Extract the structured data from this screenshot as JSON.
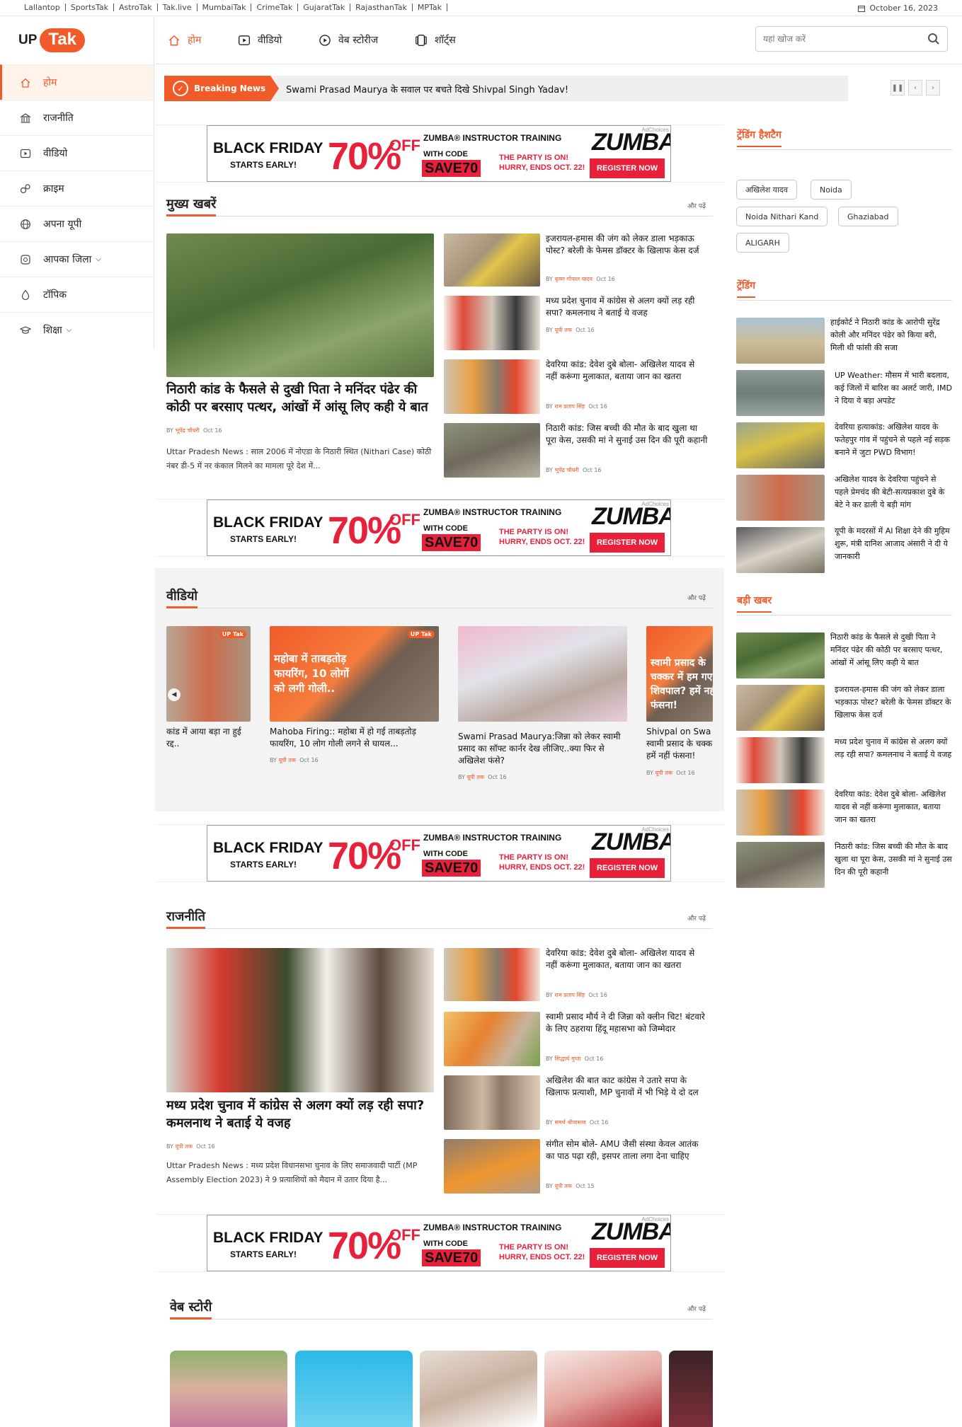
{
  "network_links": [
    "Lallantop",
    "SportsTak",
    "AstroTak",
    "Tak.live",
    "MumbaiTak",
    "CrimeTak",
    "GujaratTak",
    "RajasthanTak",
    "MPTak"
  ],
  "date": "October 16, 2023",
  "logo": {
    "up": "UP",
    "tak": "Tak"
  },
  "sidebar": {
    "items": [
      {
        "label": "होम",
        "icon": "home-icon"
      },
      {
        "label": "राजनीति",
        "icon": "parliament-icon"
      },
      {
        "label": "वीडियो",
        "icon": "video-icon"
      },
      {
        "label": "क्राइम",
        "icon": "handcuff-icon"
      },
      {
        "label": "अपना यूपी",
        "icon": "globe-icon"
      },
      {
        "label": "आपका जिला",
        "icon": "district-icon"
      },
      {
        "label": "टॉपिक",
        "icon": "topic-icon"
      },
      {
        "label": "शिक्षा",
        "icon": "graduation-cap-icon"
      }
    ]
  },
  "topnav": {
    "items": [
      {
        "label": "होम",
        "icon": "home-icon"
      },
      {
        "label": "वीडियो",
        "icon": "video-icon"
      },
      {
        "label": "वेब स्टोरीज",
        "icon": "web-stories-icon"
      },
      {
        "label": "शॉर्ट्स",
        "icon": "shorts-icon"
      }
    ],
    "search_placeholder": "यहां खोज करें"
  },
  "breaking": {
    "tag": "Breaking News",
    "text": "Swami Prasad Maurya के सवाल पर बचते दिखे Shivpal Singh Yadav!"
  },
  "ad": {
    "black_friday": "BLACK FRIDAY",
    "starts_early": "STARTS EARLY!",
    "percent": "70%",
    "off": "OFF",
    "zumba_instructor": "ZUMBA® INSTRUCTOR TRAINING",
    "with_code": "WITH CODE",
    "code": "SAVE70",
    "party": "THE PARTY IS ON!",
    "hurry": "HURRY, ENDS OCT. 22!",
    "zumba": "ZUMBA",
    "register": "REGISTER NOW",
    "adchoices": "AdChoices"
  },
  "more_label": "और पढ़ें",
  "main_news": {
    "title": "मुख्य खबरें",
    "lead": {
      "title": "निठारी कांड के फैसले से दुखी पिता ने मनिंदर पंढेर की कोठी पर बरसाए पत्थर, आंखों में आंसू लिए कही ये बात",
      "by": "BY",
      "author": "भूपेंद्र चौधरी",
      "date": "Oct 16",
      "summary": "Uttar Pradesh News : साल 2006 में नोएडा के निठारी स्थित (Nithari Case) कोठी नंबर डी-5 में नर कंकाल मिलने का मामला पूरे देश में..."
    },
    "items": [
      {
        "title": "इजरायल-हमास की जंग को लेकर डाला भड़काऊ पोस्ट? बरेली के फेमस डॉक्टर के खिलाफ केस दर्ज",
        "author": "कृष्ण गोपाल यादव",
        "date": "Oct 16"
      },
      {
        "title": "मध्य प्रदेश चुनाव में कांग्रेस से अलग क्यों लड़ रही सपा? कमलनाथ ने बताई ये वजह",
        "author": "यूपी तक",
        "date": "Oct 16"
      },
      {
        "title": "देवरिया कांड: देवेश दुबे बोला- अखिलेश यादव से नहीं करूंगा मुलाकात, बताया जान का खतरा",
        "author": "राम प्रताप सिंह",
        "date": "Oct 16"
      },
      {
        "title": "निठारी कांड: जिस बच्ची की मौत के बाद खुला था पूरा केस, उसकी मां ने सुनाई उस दिन की पूरी कहानी",
        "author": "भूपेंद्र चौधरी",
        "date": "Oct 16"
      }
    ]
  },
  "videos": {
    "title": "वीडियो",
    "items": [
      {
        "title": "कांड में आया बड़ा ना हुई रद्द..",
        "author": "",
        "date": "",
        "overlay": ""
      },
      {
        "title": "Mahoba Firing:: महोबा में हो गई ताबड़तोड़ फायरिंग, 10 लोग गोली लगने से घायल...",
        "author": "यूपी तक",
        "date": "Oct 16",
        "overlay": "महोबा में ताबड़तोड़ फायरिंग, 10 लोगों को लगी गोली.."
      },
      {
        "title": "Swami Prasad Maurya:जिन्ना को लेकर स्वामी प्रसाद का सॉफ्ट कार्नर देख लीजिए..क्या फिर से अखिलेश फंसे?",
        "author": "यूपी तक",
        "date": "Oct 16",
        "overlay": ""
      },
      {
        "title": "Shivpal on Swa स्वामी प्रसाद के चक्क हमें नहीं फंसना!",
        "author": "यूपी तक",
        "date": "Oct 16",
        "overlay": "स्वामी प्रसाद के चक्कर में हम गए शिवपाल? हमें नहीं फंसना!"
      }
    ],
    "badge": "UP Tak"
  },
  "politics": {
    "title": "राजनीति",
    "lead": {
      "title": "मध्य प्रदेश चुनाव में कांग्रेस से अलग क्यों लड़ रही सपा? कमलनाथ ने बताई ये वजह",
      "author": "यूपी तक",
      "date": "Oct 16",
      "summary": "Uttar Pradesh News : मध्य प्रदेश विधानसभा चुनाव के लिए समाजवादी पार्टी (MP Assembly Election 2023) ने 9 प्रत्याशियों को मैदान में उतार दिया है..."
    },
    "items": [
      {
        "title": "देवरिया कांड: देवेश दुबे बोला- अखिलेश यादव से नहीं करूंगा मुलाकात, बताया जान का खतरा",
        "author": "राम प्रताप सिंह",
        "date": "Oct 16"
      },
      {
        "title": "स्वामी प्रसाद मौर्य ने दी जिन्ना को क्लीन चिट! बंटवारे के लिए ठहराया हिंदू महासभा को जिम्मेदार",
        "author": "सिद्धार्थ गुप्ता",
        "date": "Oct 16"
      },
      {
        "title": "अखिलेश की बात काट कांग्रेस ने उतारे सपा के खिलाफ प्रत्याशी, MP चुनावों में भी भिड़े ये दो दल",
        "author": "समर्थ श्रीवास्तव",
        "date": "Oct 16"
      },
      {
        "title": "संगीत सोम बोले- AMU जैसी संस्था केवल आतंक का पाठ पढ़ा रही, इसपर ताला लगा देना चाहिए",
        "author": "यूपी तक",
        "date": "Oct 15"
      }
    ]
  },
  "web_story": {
    "title": "वेब स्टोरी"
  },
  "trending_hashtags": {
    "title": "ट्रेंडिंग हैशटैग",
    "tags": [
      "अखिलेश यादव",
      "Noida",
      "Noida Nithari Kand",
      "Ghaziabad",
      "ALIGARH"
    ]
  },
  "trending": {
    "title": "ट्रेंडिंग",
    "items": [
      "हाईकोर्ट ने निठारी कांड के आरोपी सुरेंद्र कोली और मनिंदर पंढेर को किया बरी, मिली थी फांसी की सजा",
      "UP Weather: मौसम में भारी बदलाव, कई जिलों में बारिश का अलर्ट जारी, IMD ने दिया ये बड़ा अपडेट",
      "देवरिया हत्याकांड: अखिलेश यादव के फतेहपुर गांव में पहुंचने से पहले नई सड़क बनाने में जुटा PWD विभाग!",
      "अखिलेश यादव के देवरिया पहुंचने से पहले प्रेमचंद की बेटी-सत्यप्रकाश दुबे के बेटे ने कर डाली ये बड़ी मांग",
      "यूपी के मदरसों में AI शिक्षा देने की मुहिम शुरू, मंत्री दानिश आजाद अंसारी ने दी ये जानकारी"
    ]
  },
  "big_news": {
    "title": "बड़ी खबर",
    "items": [
      "निठारी कांड के फैसले से दुखी पिता ने मनिंदर पंढेर की कोठी पर बरसाए पत्थर, आंखों में आंसू लिए कही ये बात",
      "इजरायल-हमास की जंग को लेकर डाला भड़काऊ पोस्ट? बरेली के फेमस डॉक्टर के खिलाफ केस दर्ज",
      "मध्य प्रदेश चुनाव में कांग्रेस से अलग क्यों लड़ रही सपा? कमलनाथ ने बताई ये वजह",
      "देवरिया कांड: देवेश दुबे बोला- अखिलेश यादव से नहीं करूंगा मुलाकात, बताया जान का खतरा",
      "निठारी कांड: जिस बच्ची की मौत के बाद खुला था पूरा केस, उसकी मां ने सुनाई उस दिन की पूरी कहानी"
    ]
  },
  "colors": {
    "accent": "#f15a29",
    "ad_red": "#e8203a"
  }
}
